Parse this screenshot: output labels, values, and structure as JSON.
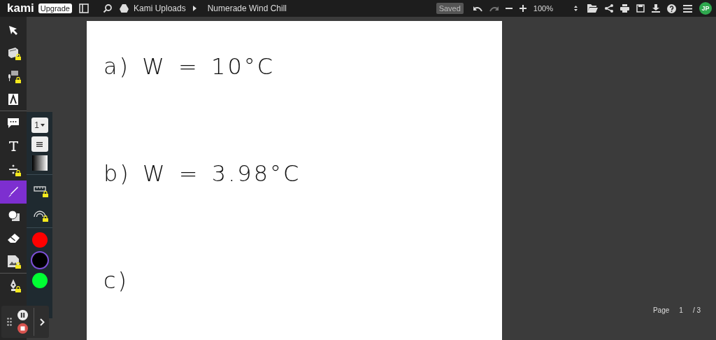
{
  "topbar": {
    "logo": "kami",
    "upgrade": "Upgrade",
    "breadcrumb": "Kami Uploads",
    "title": "Numerade Wind Chill",
    "status": "Saved",
    "zoom": "100%",
    "avatar": "JP"
  },
  "tools": [
    {
      "kind": "select",
      "locked": false,
      "selected": false
    },
    {
      "kind": "book",
      "locked": true,
      "selected": false
    },
    {
      "kind": "voice",
      "locked": true,
      "selected": false
    },
    {
      "kind": "textbox",
      "locked": false,
      "selected": false
    },
    {
      "kind": "comment",
      "locked": false,
      "selected": false
    },
    {
      "kind": "text",
      "locked": false,
      "selected": false
    },
    {
      "kind": "equation",
      "locked": true,
      "selected": false
    },
    {
      "kind": "pen",
      "locked": false,
      "selected": true
    },
    {
      "kind": "shapes",
      "locked": false,
      "selected": false
    },
    {
      "kind": "eraser",
      "locked": false,
      "selected": false
    },
    {
      "kind": "image",
      "locked": true,
      "selected": false
    },
    {
      "kind": "signature",
      "locked": true,
      "selected": false
    }
  ],
  "pen_panel": {
    "size": "1",
    "tools": [
      {
        "kind": "ruler",
        "locked": true
      },
      {
        "kind": "arc",
        "locked": true
      }
    ],
    "colors": [
      {
        "color": "#ff0000",
        "selected": false
      },
      {
        "color": "#000000",
        "selected": true
      },
      {
        "color": "#00ff33",
        "selected": false
      }
    ]
  },
  "page": {
    "lines": [
      "a)  W = 10°C",
      "b)  W = 3.98°C",
      "c)"
    ]
  },
  "pager": {
    "label": "Page",
    "current": "1",
    "total": "/ 3"
  }
}
